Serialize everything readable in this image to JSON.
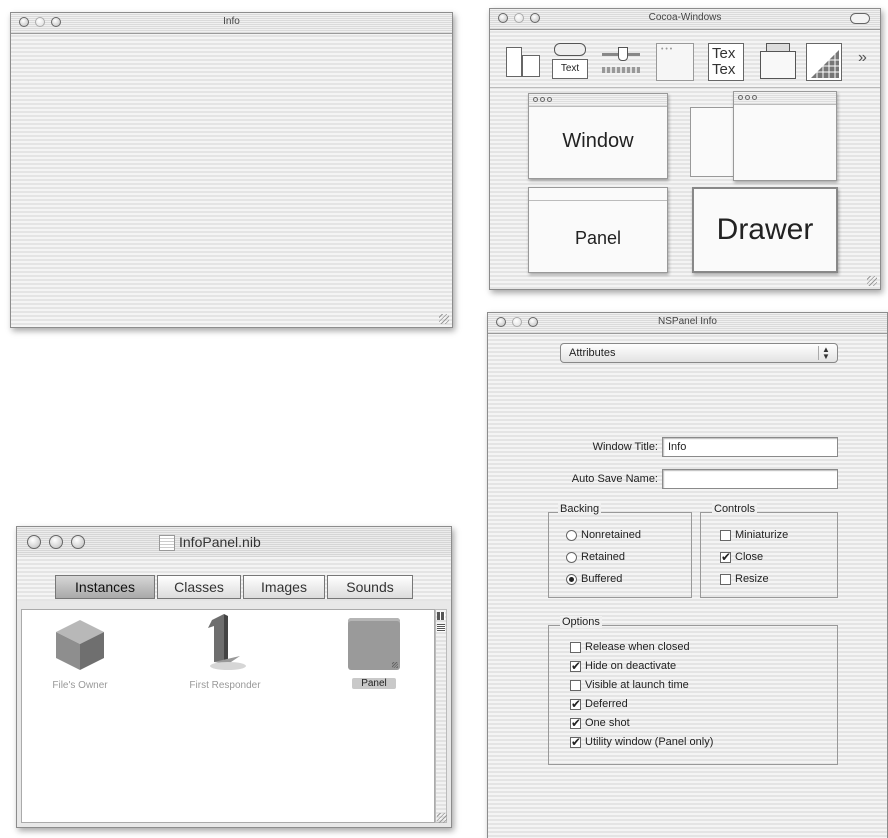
{
  "info_window": {
    "title": "Info"
  },
  "palette_window": {
    "title": "Cocoa-Windows",
    "toolbar_icons": [
      {
        "name": "views-icon"
      },
      {
        "name": "text-controls-icon",
        "label": "Text"
      },
      {
        "name": "sliders-icon"
      },
      {
        "name": "containers-icon"
      },
      {
        "name": "text-views-icon",
        "label": "Tex"
      },
      {
        "name": "windows-icon"
      },
      {
        "name": "graphics-views-icon"
      }
    ],
    "overflow_glyph": "»",
    "tiles": {
      "window": "Window",
      "panel": "Panel",
      "drawer": "Drawer"
    }
  },
  "nspanel_info": {
    "title": "NSPanel Info",
    "popup": "Attributes",
    "window_title_label": "Window Title:",
    "window_title_value": "Info",
    "auto_save_label": "Auto Save Name:",
    "auto_save_value": "",
    "backing": {
      "title": "Backing",
      "options": [
        {
          "label": "Nonretained",
          "selected": false
        },
        {
          "label": "Retained",
          "selected": false
        },
        {
          "label": "Buffered",
          "selected": true
        }
      ]
    },
    "controls": {
      "title": "Controls",
      "options": [
        {
          "label": "Miniaturize",
          "checked": false
        },
        {
          "label": "Close",
          "checked": true
        },
        {
          "label": "Resize",
          "checked": false
        }
      ]
    },
    "options": {
      "title": "Options",
      "items": [
        {
          "label": "Release when closed",
          "checked": false
        },
        {
          "label": "Hide on deactivate",
          "checked": true
        },
        {
          "label": "Visible at launch time",
          "checked": false
        },
        {
          "label": "Deferred",
          "checked": true
        },
        {
          "label": "One shot",
          "checked": true
        },
        {
          "label": "Utility window (Panel only)",
          "checked": true
        }
      ]
    }
  },
  "nib_window": {
    "title": "InfoPanel.nib",
    "tabs": [
      "Instances",
      "Classes",
      "Images",
      "Sounds"
    ],
    "selected_tab": "Instances",
    "items": [
      {
        "label": "File's Owner",
        "icon": "cube-icon",
        "selected": false
      },
      {
        "label": "First Responder",
        "icon": "first-responder-icon",
        "selected": false
      },
      {
        "label": "Panel",
        "icon": "panel-icon",
        "selected": true
      }
    ]
  }
}
